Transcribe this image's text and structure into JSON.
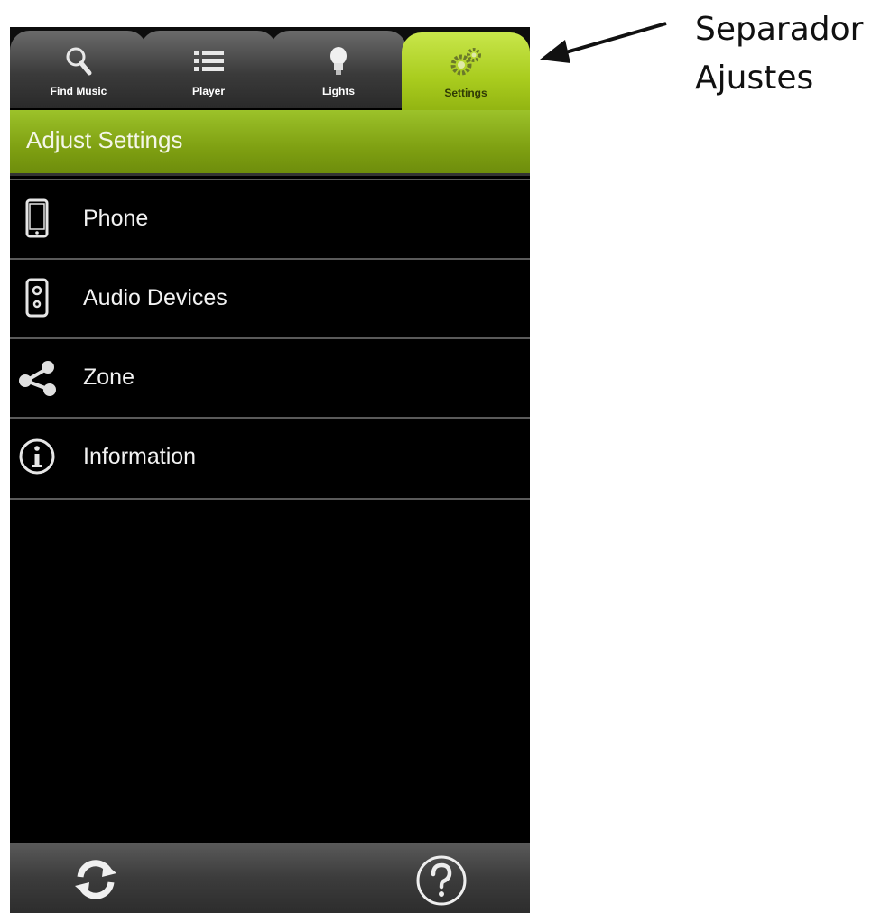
{
  "tabs": [
    {
      "label": "Find Music",
      "icon": "search-icon",
      "selected": false
    },
    {
      "label": "Player",
      "icon": "list-icon",
      "selected": false
    },
    {
      "label": "Lights",
      "icon": "lightbulb-icon",
      "selected": false
    },
    {
      "label": "Settings",
      "icon": "gears-icon",
      "selected": true
    }
  ],
  "header": {
    "title": "Adjust Settings"
  },
  "menu": [
    {
      "label": "Phone",
      "icon": "phone-icon"
    },
    {
      "label": "Audio Devices",
      "icon": "speaker-icon"
    },
    {
      "label": "Zone",
      "icon": "share-icon"
    },
    {
      "label": "Information",
      "icon": "info-icon"
    }
  ],
  "bottom_bar": {
    "left_icon": "refresh-icon",
    "right_icon": "help-icon"
  },
  "annotation": {
    "line1": "Separador",
    "line2": "Ajustes"
  },
  "colors": {
    "accent_green": "#a9cc1e",
    "header_green": "#7fa012",
    "background": "#000000"
  }
}
